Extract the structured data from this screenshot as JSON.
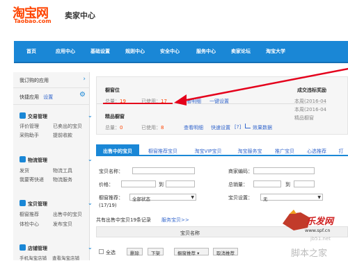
{
  "header": {
    "logo": "淘宝网",
    "logo_sub": "Taobao.com",
    "seller_center": "卖家中心"
  },
  "nav": [
    "首页",
    "应用中心",
    "基础设置",
    "规则中心",
    "安全中心",
    "服务中心",
    "卖家论坛",
    "淘宝大学"
  ],
  "sidebar": {
    "my_apps": "我订购的应用",
    "quick_apps": "快捷应用",
    "settings": "设置",
    "sections": [
      {
        "title": "交易管理",
        "items": [
          "评价管理",
          "已卖出的宝贝",
          "采购助手",
          "提前收款"
        ]
      },
      {
        "title": "物流管理",
        "items": [
          "发货",
          "物流工具",
          "我要寄快递",
          "物流服务"
        ]
      },
      {
        "title": "宝贝管理",
        "items": [
          "橱窗推荐",
          "出售中的宝贝",
          "体检中心",
          "发布宝贝"
        ]
      },
      {
        "title": "店铺管理",
        "items": [
          "手机淘宝店铺",
          "查看淘宝店铺"
        ]
      }
    ]
  },
  "showcase": {
    "title": "橱窗位",
    "total_label": "总量：",
    "total": "19",
    "used_label": "已使用：",
    "used": "17",
    "detail": "查看明细",
    "one_click": "一键设置",
    "fine_title": "精品橱窗",
    "fine_total": "0",
    "fine_used": "8",
    "fine_detail": "查看明细",
    "quick_set": "快速设置",
    "help": "[?]",
    "effect": "效果数据"
  },
  "trade": {
    "title": "成交违标奖励",
    "line1": "本周(2016-04",
    "line2": "本周(2016-04",
    "line3": "精品橱窗"
  },
  "tabs": [
    "出售中的宝贝",
    "橱窗推荐宝贝",
    "淘宝VIP宝贝",
    "淘宝服务宝",
    "推广宝贝",
    "心选推荐",
    "打"
  ],
  "filters": {
    "name": "宝贝名称：",
    "code": "商家编码：",
    "price": "价格：",
    "to": "到",
    "sales": "总销量：",
    "to2": "到",
    "recommend": "橱窗推荐：",
    "recommend_value": "全部状态",
    "count": "(17/19)",
    "setting": "宝贝设置：",
    "setting_value": "无"
  },
  "list": {
    "summary": "共有出售中宝贝19条记录",
    "service": "服务宝贝>>",
    "col_name": "宝贝名称"
  },
  "actions": {
    "select_all": "全选",
    "delete": "删除",
    "down": "下架",
    "recommend": "橱窗推荐",
    "cancel": "取消推荐"
  },
  "watermark": {
    "brand": "乐发网",
    "url": "www.spf.cn",
    "site": "脚本之家",
    "url2": "jb51.net"
  },
  "colors": {
    "brand": "#ff4400",
    "nav": "#1a87d6"
  }
}
